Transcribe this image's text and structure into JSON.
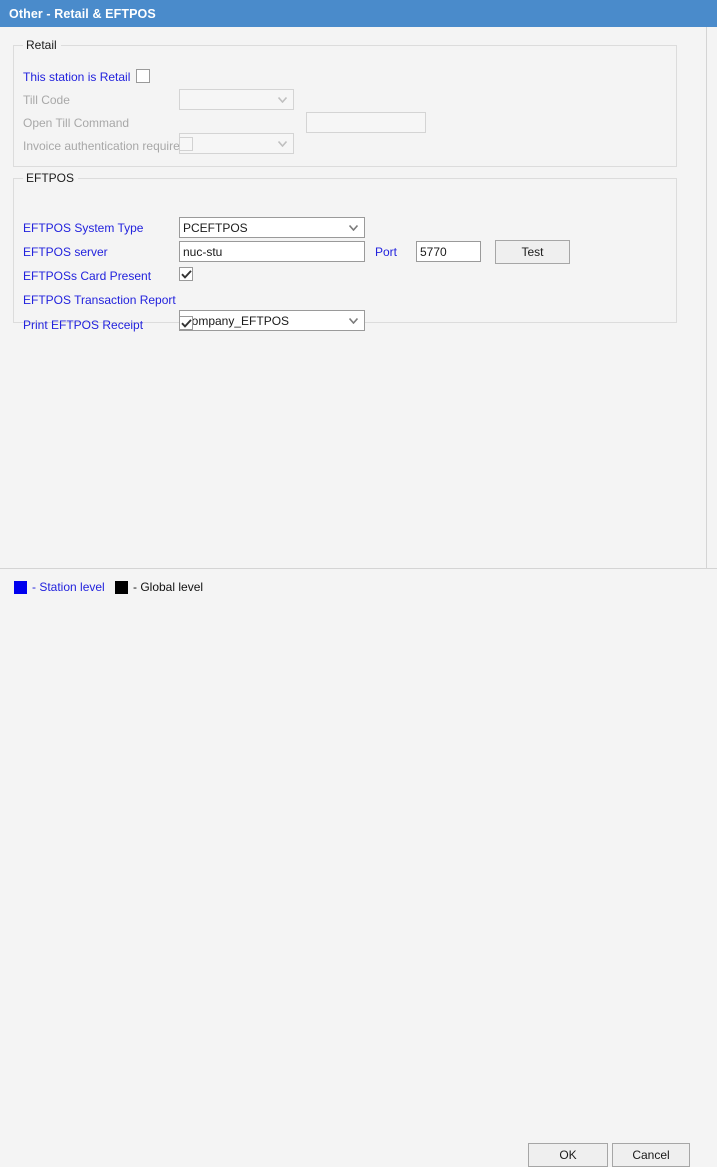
{
  "window": {
    "title": "Other - Retail & EFTPOS"
  },
  "colors": {
    "titlebar_blue": "#4a8bcb",
    "station_level": "#2222dd",
    "global_level": "#111111",
    "page_background": "#f4f4f4"
  },
  "retail_group": {
    "legend": "Retail",
    "rows": {
      "station_is_retail": {
        "label": "This station is Retail",
        "checked": false,
        "enabled": true
      },
      "till_code": {
        "label": "Till Code",
        "value": "",
        "enabled": false
      },
      "open_till_command": {
        "label": "Open Till Command",
        "value": "",
        "text_value": "",
        "enabled": false
      },
      "invoice_auth": {
        "label": "Invoice authentication required",
        "checked": false,
        "enabled": false
      }
    }
  },
  "eftpos_group": {
    "legend": "EFTPOS",
    "rows": {
      "system_type": {
        "label": "EFTPOS System Type",
        "value": "PCEFTPOS",
        "enabled": true
      },
      "server": {
        "label": "EFTPOS server",
        "value": "nuc-stu",
        "port_label": "Port",
        "port_value": "5770",
        "test_button": "Test",
        "enabled": true
      },
      "card_present": {
        "label": "EFTPOSs Card Present",
        "checked": true,
        "enabled": true
      },
      "transaction_report": {
        "label": "EFTPOS Transaction Report",
        "value": "Company_EFTPOS",
        "enabled": true
      },
      "print_receipt": {
        "label": "Print EFTPOS Receipt",
        "checked": true,
        "enabled": true
      }
    }
  },
  "footer": {
    "legend_station": "- Station level",
    "legend_global": "- Global level",
    "ok_label": "OK",
    "cancel_label": "Cancel"
  }
}
